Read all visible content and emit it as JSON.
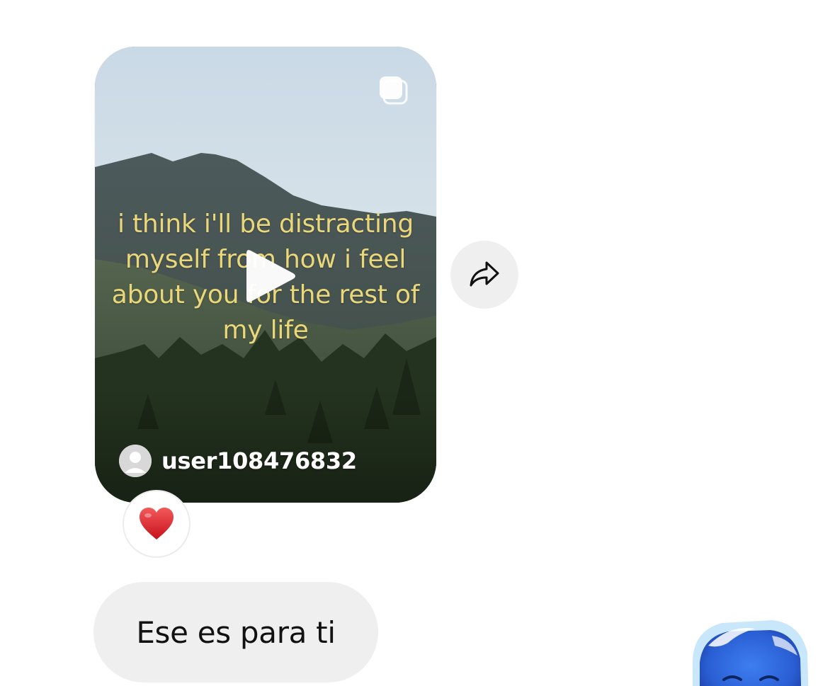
{
  "shared_reel": {
    "overlay_caption": "i think i'll be distracting\nmyself from how i feel\nabout you for the rest of\nmy life",
    "author": "user108476832",
    "icons": {
      "multi": "carousel-stack-icon",
      "play": "play-icon",
      "avatar": "default-avatar-icon"
    }
  },
  "actions": {
    "share_icon": "share-forward-icon"
  },
  "reaction": {
    "emoji": "❤️"
  },
  "message": {
    "text": "Ese es para ti"
  },
  "sticker": {
    "icon": "cold-face-emoji"
  },
  "colors": {
    "caption_text": "#e9d77a",
    "bubble_bg": "#efefef",
    "share_bg": "#efefef"
  }
}
